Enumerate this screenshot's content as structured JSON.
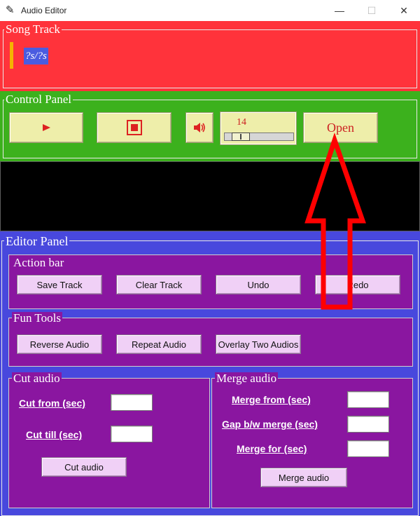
{
  "window": {
    "title": "Audio Editor",
    "minimize_glyph": "—",
    "maximize_glyph": "☐",
    "close_glyph": "✕"
  },
  "song_track": {
    "legend": "Song Track",
    "time_label": "?s/?s"
  },
  "control_panel": {
    "legend": "Control Panel",
    "play_icon": "play-icon",
    "stop_icon": "stop-icon",
    "volume_icon": "volume-icon",
    "volume_value": "14",
    "volume_level": 0.14,
    "open_label": "Open"
  },
  "editor_panel": {
    "legend": "Editor Panel",
    "action_bar": {
      "legend": "Action bar",
      "buttons": [
        "Save Track",
        "Clear Track",
        "Undo",
        "Redo"
      ]
    },
    "fun_tools": {
      "legend": "Fun Tools",
      "buttons": [
        "Reverse Audio",
        "Repeat Audio",
        "Overlay Two Audios"
      ]
    },
    "cut_audio": {
      "legend": "Cut audio",
      "from_label": "Cut from (sec)",
      "till_label": "Cut till (sec)",
      "button": "Cut audio"
    },
    "merge_audio": {
      "legend": "Merge audio",
      "from_label": "Merge from (sec)",
      "gap_label": "Gap b/w merge (sec)",
      "for_label": "Merge for (sec)",
      "button": "Merge audio"
    }
  },
  "colors": {
    "song_track_bg": "#ff333b",
    "control_panel_bg": "#3cb11d",
    "display_bg": "#000000",
    "editor_panel_bg": "#4848dd",
    "sub_panel_bg": "#8a16a0",
    "annotation_arrow": "#ff0000"
  }
}
